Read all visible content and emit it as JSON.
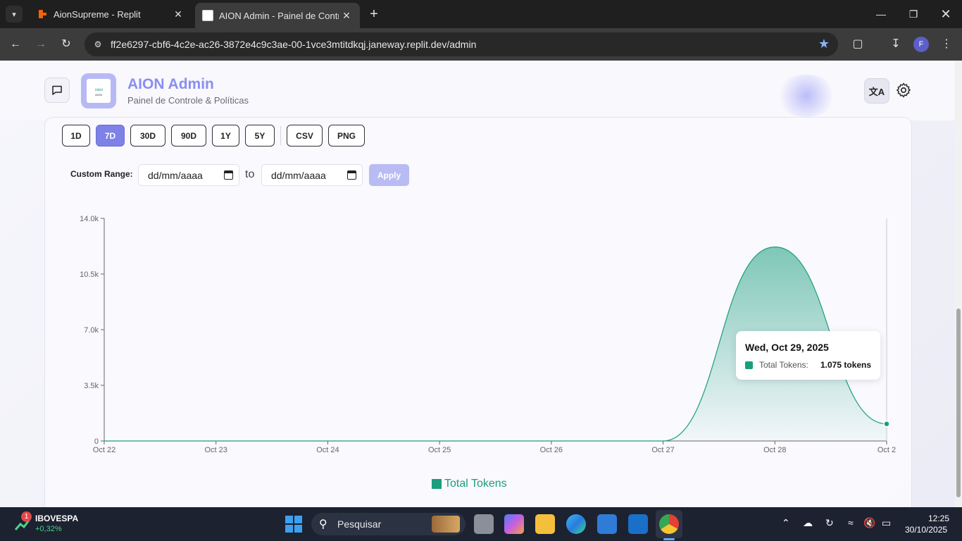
{
  "browser": {
    "tabs": [
      {
        "title": "AionSupreme - Replit",
        "active": false
      },
      {
        "title": "AION Admin - Painel de Contro",
        "active": true
      }
    ],
    "url": "ff2e6297-cbf6-4c2e-ac26-3872e4c9c3ae-00-1vce3mtitdkqj.janeway.replit.dev/admin",
    "profile_initial": "F"
  },
  "header": {
    "title": "AION Admin",
    "subtitle": "Painel de Controle & Políticas",
    "logo_text": "AION"
  },
  "range_buttons": [
    {
      "label": "1D",
      "active": false
    },
    {
      "label": "7D",
      "active": true
    },
    {
      "label": "30D",
      "active": false
    },
    {
      "label": "90D",
      "active": false
    },
    {
      "label": "1Y",
      "active": false
    },
    {
      "label": "5Y",
      "active": false
    }
  ],
  "export_buttons": [
    "CSV",
    "PNG"
  ],
  "custom_range": {
    "label": "Custom Range:",
    "from_placeholder": "dd/mm/aaaa",
    "to_label": "to",
    "to_placeholder": "dd/mm/aaaa",
    "apply_label": "Apply"
  },
  "chart_data": {
    "type": "area",
    "categories": [
      "Oct 22",
      "Oct 23",
      "Oct 24",
      "Oct 25",
      "Oct 26",
      "Oct 27",
      "Oct 28",
      "Oct 2"
    ],
    "series": [
      {
        "name": "Total Tokens",
        "values": [
          0,
          0,
          0,
          0,
          0,
          0,
          12200,
          1075
        ],
        "color": "#1a9e7c"
      }
    ],
    "y_ticks": [
      "0",
      "3.5k",
      "7.0k",
      "10.5k",
      "14.0k"
    ],
    "ylim": [
      0,
      14000
    ],
    "legend": "bottom-center",
    "grid": false
  },
  "tooltip": {
    "title": "Wed, Oct 29, 2025",
    "key": "Total Tokens:",
    "value": "1.075 tokens"
  },
  "taskbar": {
    "stock_name": "IBOVESPA",
    "stock_change": "+0,32%",
    "stock_badge": "1",
    "search_placeholder": "Pesquisar",
    "time": "12:25",
    "date": "30/10/2025",
    "colors": {
      "accent": "#3ca0f0",
      "positive": "#4cd18b"
    }
  }
}
